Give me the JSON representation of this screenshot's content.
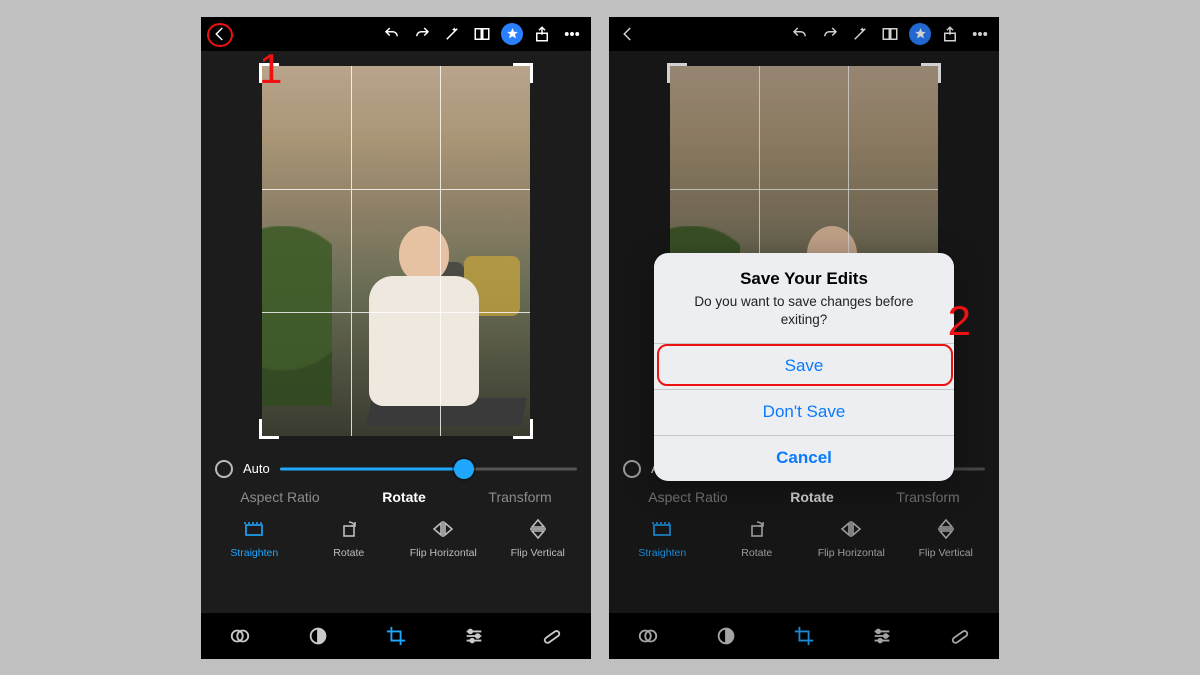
{
  "annotations": {
    "step1": "1",
    "step2": "2"
  },
  "topbar_icons": [
    "back",
    "undo",
    "redo",
    "magic",
    "compare",
    "star",
    "export",
    "more"
  ],
  "slider": {
    "auto_label": "Auto",
    "value_pct": 62
  },
  "tabs": {
    "aspect_ratio": "Aspect Ratio",
    "rotate": "Rotate",
    "transform": "Transform",
    "active": "rotate"
  },
  "tools": {
    "straighten": "Straighten",
    "rotate": "Rotate",
    "flip_h": "Flip Horizontal",
    "flip_v": "Flip Vertical",
    "active": "straighten"
  },
  "bottom_icons": [
    "looks",
    "contrast",
    "crop",
    "adjust",
    "heal"
  ],
  "alert": {
    "title": "Save Your Edits",
    "message": "Do you want to save changes before exiting?",
    "save": "Save",
    "dont_save": "Don't Save",
    "cancel": "Cancel"
  }
}
